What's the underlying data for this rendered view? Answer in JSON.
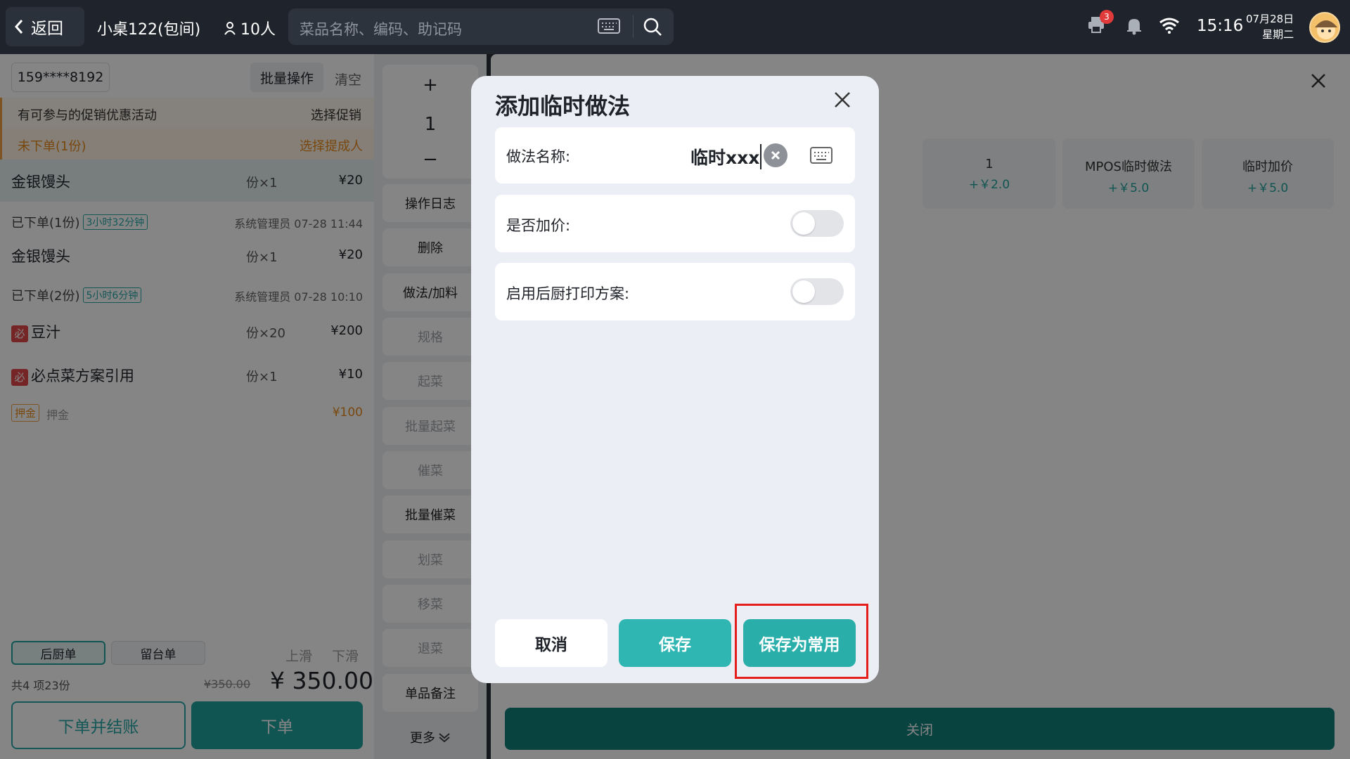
{
  "topbar": {
    "back_label": "返回",
    "table_name": "小桌122(包间)",
    "guests": "10人",
    "search_placeholder": "菜品名称、编码、助记码",
    "printer_badge": "3",
    "time": "15:16",
    "date": "07月28日",
    "weekday": "星期二"
  },
  "left": {
    "phone": "159****8192",
    "batch_label": "批量操作",
    "clear_label": "清空",
    "promo_text": "有可参与的促销优惠活动",
    "promo_action": "选择促销",
    "unordered_text": "未下单(1份)",
    "unordered_action": "选择提成人",
    "dishes": [
      {
        "name": "金银馒头",
        "qty": "份×1",
        "price": "¥20"
      },
      {
        "name": "金银馒头",
        "qty": "份×1",
        "price": "¥20"
      },
      {
        "name": "豆汁",
        "qty": "份×20",
        "price": "¥200",
        "badge": "必"
      },
      {
        "name": "必点菜方案引用",
        "qty": "份×1",
        "price": "¥10",
        "badge": "必"
      }
    ],
    "ordered_groups": [
      {
        "label": "已下单(1份)",
        "tag": "3小时32分钟",
        "meta": "系统管理员 07-28 11:44"
      },
      {
        "label": "已下单(2份)",
        "tag": "5小时6分钟",
        "meta": "系统管理员 07-28 10:10"
      }
    ],
    "deposit": {
      "tag": "押金",
      "label": "押金",
      "price": "¥100"
    },
    "tabs": [
      "后厨单",
      "留台单"
    ],
    "slide_up": "上滑",
    "slide_down": "下滑",
    "summary": "共4 项23份",
    "old_total": "¥350.00",
    "total": "¥ 350.00",
    "checkout_label": "下单并结账",
    "order_label": "下单"
  },
  "ops": {
    "plus": "+",
    "qty": "1",
    "minus": "−",
    "buttons": [
      "操作日志",
      "删除",
      "做法/加料",
      "规格",
      "起菜",
      "批量起菜",
      "催菜",
      "批量催菜",
      "划菜",
      "移菜",
      "退菜",
      "单品备注",
      "更多"
    ]
  },
  "right": {
    "options": [
      {
        "name": "1",
        "price": "+￥2.0"
      },
      {
        "name": "MPOS临时做法",
        "price": "+￥5.0"
      },
      {
        "name": "临时加价",
        "price": "+￥5.0"
      }
    ],
    "close_label": "关闭"
  },
  "dialog": {
    "title": "添加临时做法",
    "name_label": "做法名称:",
    "name_value": "临时xxx",
    "surcharge_label": "是否加价:",
    "surcharge_on": false,
    "kitchen_label": "启用后厨打印方案:",
    "kitchen_on": false,
    "cancel_label": "取消",
    "save_label": "保存",
    "save_common_label": "保存为常用"
  },
  "colors": {
    "accent": "#20a39e",
    "highlight": "#e51d1d"
  }
}
